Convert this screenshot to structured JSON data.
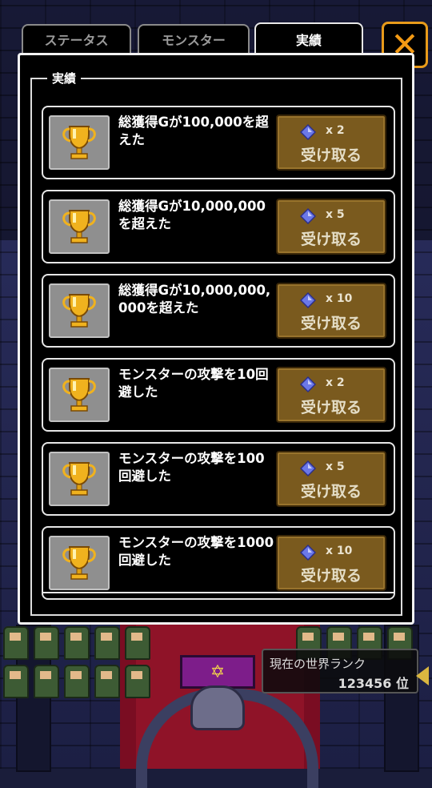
{
  "tabs": [
    {
      "label": "ステータス",
      "active": false
    },
    {
      "label": "モンスター",
      "active": false
    },
    {
      "label": "実績",
      "active": true
    }
  ],
  "close_label": "✕",
  "panel": {
    "title": "実績"
  },
  "achievements": [
    {
      "text": "総獲得Gが100,000を超えた",
      "reward": "x 2",
      "button": "受け取る"
    },
    {
      "text": "総獲得Gが10,000,000を超えた",
      "reward": "x 5",
      "button": "受け取る"
    },
    {
      "text": "総獲得Gが10,000,000,000を超えた",
      "reward": "x 10",
      "button": "受け取る"
    },
    {
      "text": "モンスターの攻撃を10回避した",
      "reward": "x 2",
      "button": "受け取る"
    },
    {
      "text": "モンスターの攻撃を100回避した",
      "reward": "x 5",
      "button": "受け取る"
    },
    {
      "text": "モンスターの攻撃を1000回避した",
      "reward": "x 10",
      "button": "受け取る"
    }
  ],
  "ranking": {
    "label": "現在の世界ランク",
    "value": "123456 位"
  },
  "icons": {
    "achievement": "trophy-icon",
    "reward": "gem-icon"
  },
  "colors": {
    "accent": "#f39a14",
    "button": "#7a5a1e",
    "trophy": "#f0b21e"
  }
}
